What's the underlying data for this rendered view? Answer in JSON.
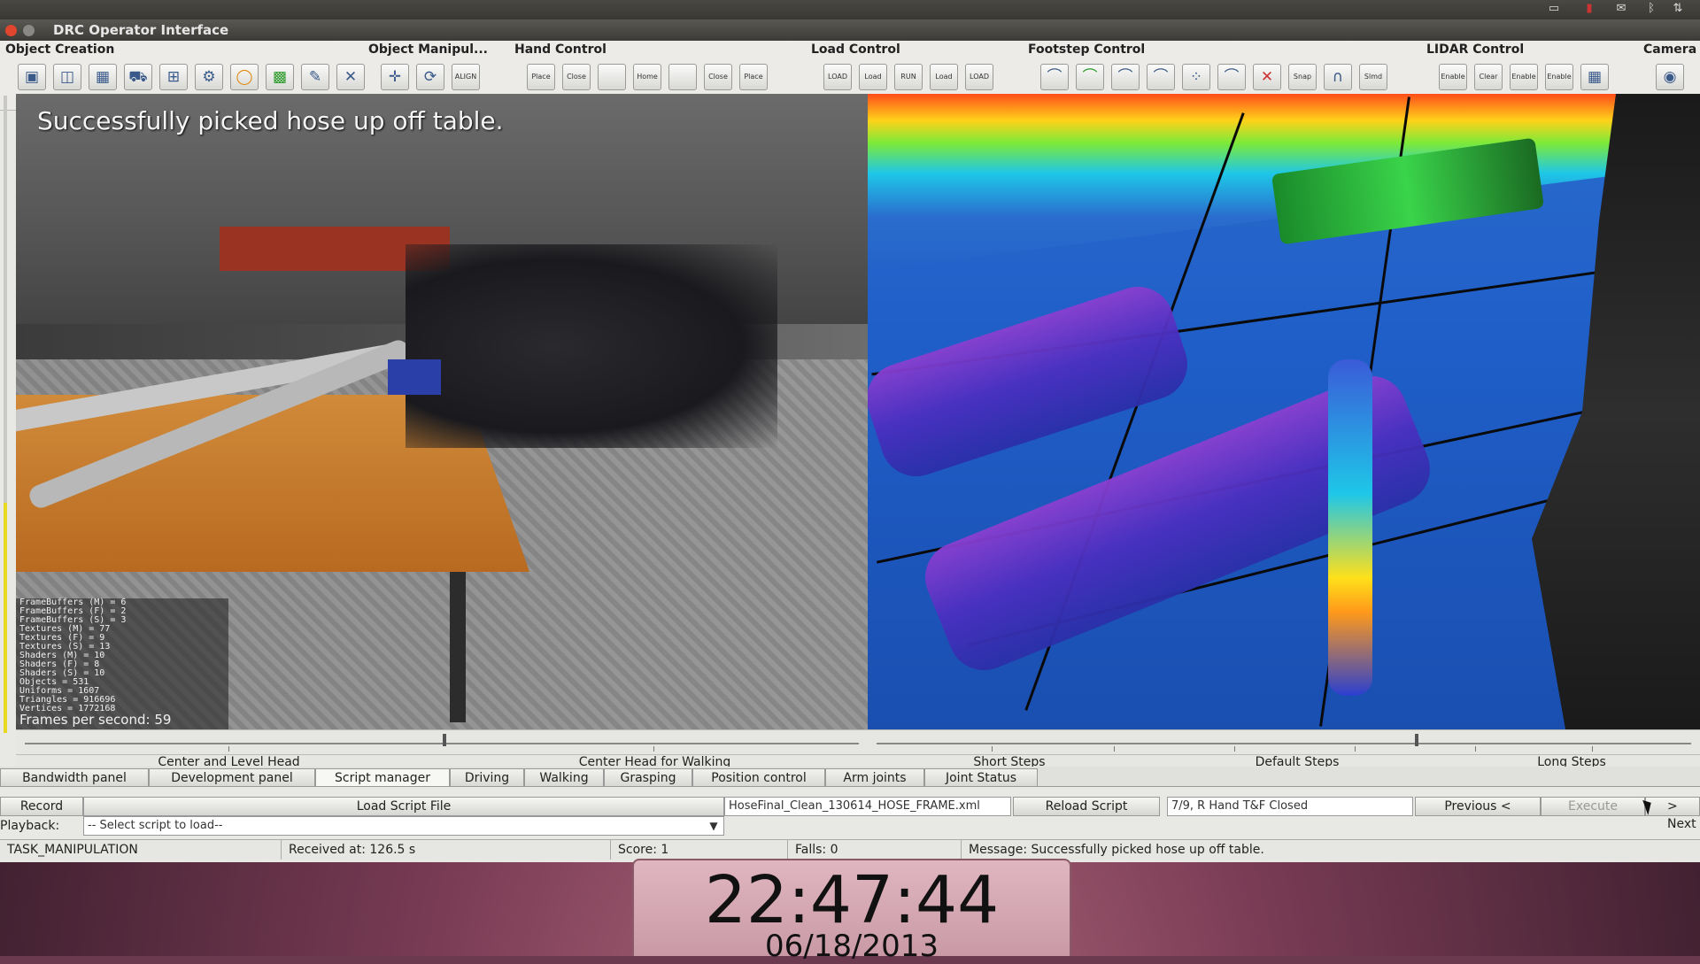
{
  "window": {
    "title": "DRC Operator Interface"
  },
  "toolbar": {
    "groups": [
      {
        "label": "Object Creation",
        "buttons": [
          "",
          "",
          "",
          "",
          "",
          "",
          "",
          "",
          ""
        ]
      },
      {
        "label": "Object Manipul...",
        "buttons": [
          "",
          "",
          "ALIGN"
        ]
      },
      {
        "label": "Hand Control",
        "buttons": [
          "Place",
          "Close",
          "",
          "Home",
          "",
          "Close",
          "Place"
        ]
      },
      {
        "label": "Load Control",
        "buttons": [
          "LOAD",
          "Load",
          "RUN LOAD",
          "Load",
          "LOAD"
        ]
      },
      {
        "label": "Footstep Control",
        "buttons": [
          "",
          "",
          "",
          "",
          "",
          "",
          "",
          "Snap",
          "",
          "Slmd"
        ]
      },
      {
        "label": "LIDAR Control",
        "buttons": [
          "Enable",
          "Clear",
          "Enable",
          "Enable",
          ""
        ]
      },
      {
        "label": "Camera",
        "buttons": [
          ""
        ]
      }
    ]
  },
  "left_view": {
    "overlay": "Successfully picked hose up off table.",
    "stats": [
      "FrameBuffers (M) = 6",
      "FrameBuffers (F) = 2",
      "FrameBuffers (S) = 3",
      "Textures (M) = 77",
      "Textures (F) = 9",
      "Textures (S) = 13",
      "Shaders (M) = 10",
      "Shaders (F) = 8",
      "Shaders (S) = 10",
      "Objects = 531",
      "Uniforms = 1607",
      "Triangles = 916696",
      "Vertices = 1772168"
    ],
    "fps": "Frames per second: 59"
  },
  "sliders": {
    "head_labels": [
      "Center and Level Head",
      "Center Head for Walking"
    ],
    "step_labels": [
      "Short Steps",
      "Default Steps",
      "Long Steps"
    ]
  },
  "tabs": [
    "Bandwidth panel",
    "Development panel",
    "Script manager",
    "Driving",
    "Walking",
    "Grasping",
    "Position control",
    "Arm joints",
    "Joint Status"
  ],
  "script": {
    "record": "Record",
    "load_script_file": "Load Script File",
    "filename": "HoseFinal_Clean_130614_HOSE_FRAME.xml",
    "reload": "Reload Script",
    "step": "7/9, R Hand T&F Closed",
    "previous": "Previous <",
    "execute": "Execute",
    "next": "> Next",
    "playback_label": "Playback:",
    "playback_select": "-- Select script to load--"
  },
  "status": {
    "task": "TASK_MANIPULATION",
    "received": "Received at:  126.5 s",
    "score": "Score:  1",
    "falls": "Falls:  0",
    "message": "Message:  Successfully picked hose up off table."
  },
  "clock": {
    "time": "22:47:44",
    "date": "06/18/2013"
  },
  "colors": {
    "close": "#e0452e",
    "accent": "#3a5a8a"
  }
}
